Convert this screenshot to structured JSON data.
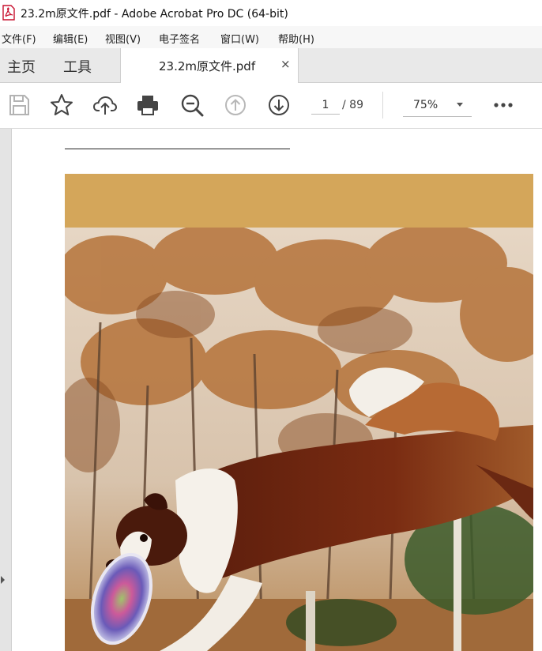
{
  "window": {
    "title": "23.2m原文件.pdf - Adobe Acrobat Pro DC (64-bit)",
    "app_icon": "pdf-file-icon"
  },
  "menu": {
    "items": [
      {
        "label": "文件(F)"
      },
      {
        "label": "编辑(E)"
      },
      {
        "label": "视图(V)"
      },
      {
        "label": "电子签名"
      },
      {
        "label": "窗口(W)"
      },
      {
        "label": "帮助(H)"
      }
    ]
  },
  "tabs": {
    "home": "主页",
    "tools": "工具",
    "document": "23.2m原文件.pdf",
    "close_glyph": "×"
  },
  "toolbar": {
    "icons": [
      "save-icon",
      "bookmark-star-icon",
      "upload-cloud-icon",
      "print-icon",
      "zoom-out-icon",
      "page-up-icon",
      "page-down-icon",
      "more-icon"
    ],
    "current_page": "1",
    "total_pages": "/ 89",
    "zoom": "75%",
    "more_glyph": "•••"
  },
  "document": {
    "header_band_color": "#d4a65a",
    "image_subject": "border collie catching frisbee"
  }
}
